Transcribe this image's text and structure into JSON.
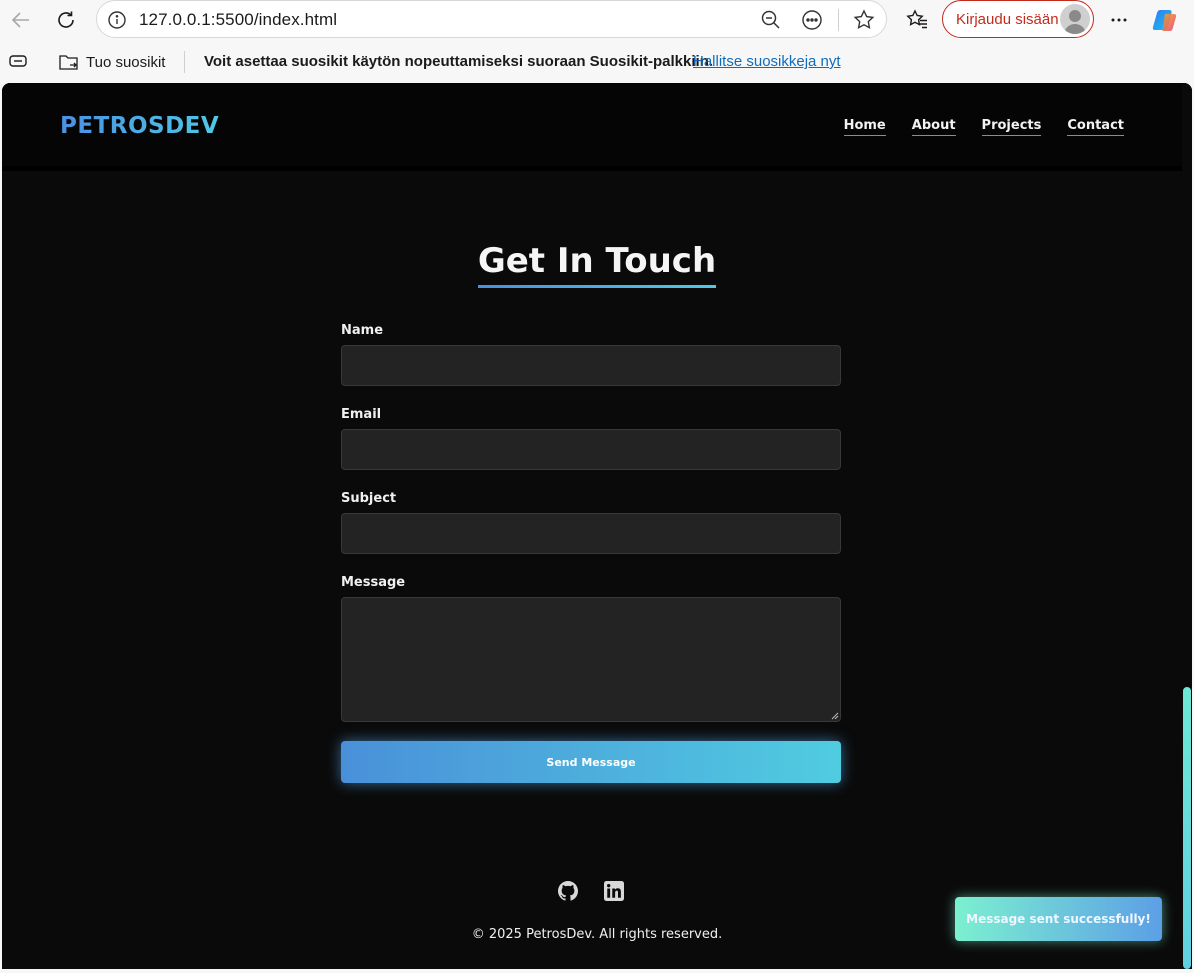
{
  "browser": {
    "url": "127.0.0.1:5500/index.html",
    "signin_label": "Kirjaudu sisään",
    "icons": [
      "back-icon",
      "refresh-icon",
      "info-icon",
      "zoom-out-icon",
      "more-actions-icon",
      "favorite-star-icon",
      "favorites-icon",
      "menu-icon",
      "copilot-icon"
    ]
  },
  "bookmarks_bar": {
    "import_label": "Tuo suosikit",
    "message": "Voit asettaa suosikit käytön nopeuttamiseksi suoraan Suosikit-palkkiin.",
    "manage_link": "Hallitse suosikkeja nyt"
  },
  "page": {
    "brand": "PETROSDEV",
    "nav": [
      {
        "label": "Home"
      },
      {
        "label": "About"
      },
      {
        "label": "Projects"
      },
      {
        "label": "Contact"
      }
    ],
    "section_title": "Get In Touch",
    "form": {
      "name_label": "Name",
      "email_label": "Email",
      "subject_label": "Subject",
      "message_label": "Message",
      "name_value": "",
      "email_value": "",
      "subject_value": "",
      "message_value": "",
      "submit_label": "Send Message"
    },
    "socials": [
      "github-icon",
      "linkedin-icon"
    ],
    "copyright": "© 2025 PetrosDev. All rights reserved.",
    "toast": "Message sent successfully!"
  },
  "colors": {
    "accent_blue": "#4a90e2",
    "accent_cyan": "#50c9e6",
    "page_bg": "#0a0a0a",
    "toast_start": "#7cf0d0",
    "signin_red": "#c42b1c"
  }
}
